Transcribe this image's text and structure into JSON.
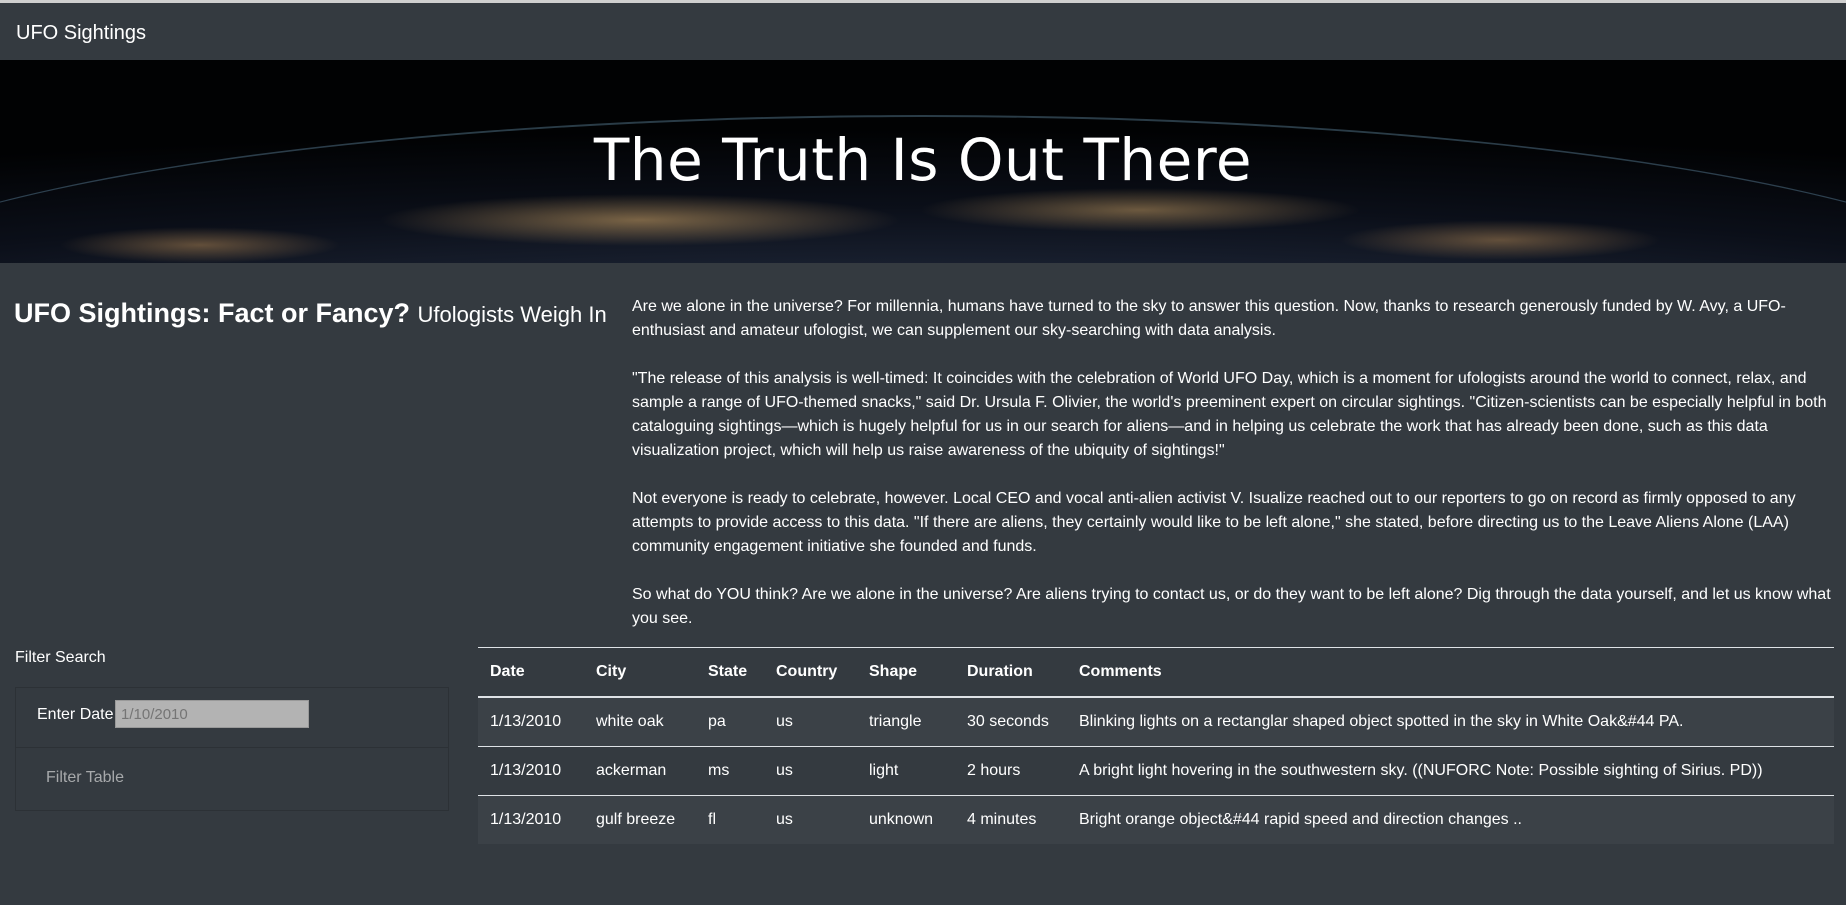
{
  "navbar": {
    "brand": "UFO Sightings"
  },
  "hero": {
    "title": "The Truth Is Out There"
  },
  "article": {
    "heading": "UFO Sightings: Fact or Fancy?",
    "subheading": "Ufologists Weigh In",
    "paragraphs": [
      "Are we alone in the universe? For millennia, humans have turned to the sky to answer this question. Now, thanks to research generously funded by W. Avy, a UFO-enthusiast and amateur ufologist, we can supplement our sky-searching with data analysis.",
      "\"The release of this analysis is well-timed: It coincides with the celebration of World UFO Day, which is a moment for ufologists around the world to connect, relax, and sample a range of UFO-themed snacks,\" said Dr. Ursula F. Olivier, the world's preeminent expert on circular sightings. \"Citizen-scientists can be especially helpful in both cataloguing sightings—which is hugely helpful for us in our search for aliens—and in helping us celebrate the work that has already been done, such as this data visualization project, which will help us raise awareness of the ubiquity of sightings!\"",
      "Not everyone is ready to celebrate, however. Local CEO and vocal anti-alien activist V. Isualize reached out to our reporters to go on record as firmly opposed to any attempts to provide access to this data. \"If there are aliens, they certainly would like to be left alone,\" she stated, before directing us to the Leave Aliens Alone (LAA) community engagement initiative she founded and funds.",
      "So what do YOU think? Are we alone in the universe? Are aliens trying to contact us, or do they want to be left alone? Dig through the data yourself, and let us know what you see."
    ]
  },
  "filter": {
    "title": "Filter Search",
    "date_label": "Enter Date",
    "date_placeholder": "1/10/2010",
    "button_label": "Filter Table"
  },
  "table": {
    "headers": [
      "Date",
      "City",
      "State",
      "Country",
      "Shape",
      "Duration",
      "Comments"
    ],
    "rows": [
      [
        "1/13/2010",
        "white oak",
        "pa",
        "us",
        "triangle",
        "30 seconds",
        "Blinking lights on a rectanglar shaped object spotted in the sky in White Oak&#44 PA."
      ],
      [
        "1/13/2010",
        "ackerman",
        "ms",
        "us",
        "light",
        "2 hours",
        "A bright light hovering in the southwestern sky. ((NUFORC Note: Possible sighting of Sirius. PD))"
      ],
      [
        "1/13/2010",
        "gulf breeze",
        "fl",
        "us",
        "unknown",
        "4 minutes",
        "Bright orange object&#44 rapid speed and direction changes .."
      ]
    ]
  }
}
